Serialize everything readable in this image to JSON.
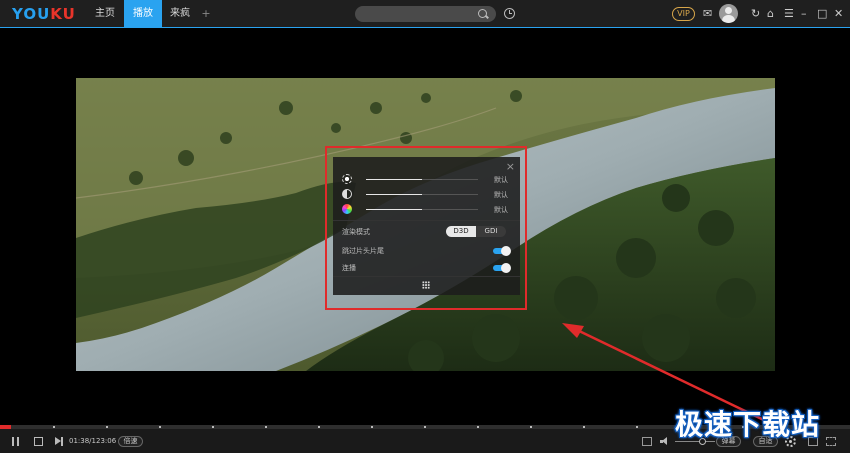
{
  "app": {
    "logo_part1": "YOU",
    "logo_part2": "KU",
    "brand_colors": {
      "blue": "#27a0ef",
      "red": "#e8342a"
    }
  },
  "titlebar": {
    "nav": [
      {
        "label": "主页",
        "active": false
      },
      {
        "label": "播放",
        "active": true
      },
      {
        "label": "来疯",
        "active": false
      }
    ],
    "add_tab_label": "+",
    "search": {
      "placeholder": "",
      "icon": "search-icon"
    },
    "history_icon": "history-icon",
    "vip_label": "VIP",
    "icons": [
      "mail-icon",
      "avatar",
      "refresh-icon",
      "skin-icon",
      "menu-icon",
      "minimize-icon",
      "maximize-icon",
      "close-icon"
    ],
    "accent_color": "#2aa3f0"
  },
  "settings_panel": {
    "close_label": "×",
    "sliders": [
      {
        "name": "brightness",
        "icon": "brightness-icon",
        "default_label": "默认",
        "level": 0.5
      },
      {
        "name": "contrast",
        "icon": "contrast-icon",
        "default_label": "默认",
        "level": 0.5
      },
      {
        "name": "saturation",
        "icon": "saturation-icon",
        "default_label": "默认",
        "level": 0.5
      }
    ],
    "render_mode": {
      "label": "渲染模式",
      "options": [
        "D3D",
        "GDI"
      ],
      "selected": "D3D"
    },
    "skip_intro": {
      "label": "跳过片头片尾",
      "on": true
    },
    "continuous_play": {
      "label": "连播",
      "on": true
    },
    "more_icon": "grid-icon"
  },
  "player": {
    "progress_played": 0.0126,
    "time_display": "01:38/123:06",
    "speed_label": "倍速",
    "danmaku_label": "弹幕",
    "quality_label": "自适",
    "volume_level": 0.65
  },
  "watermark": "极速下载站"
}
